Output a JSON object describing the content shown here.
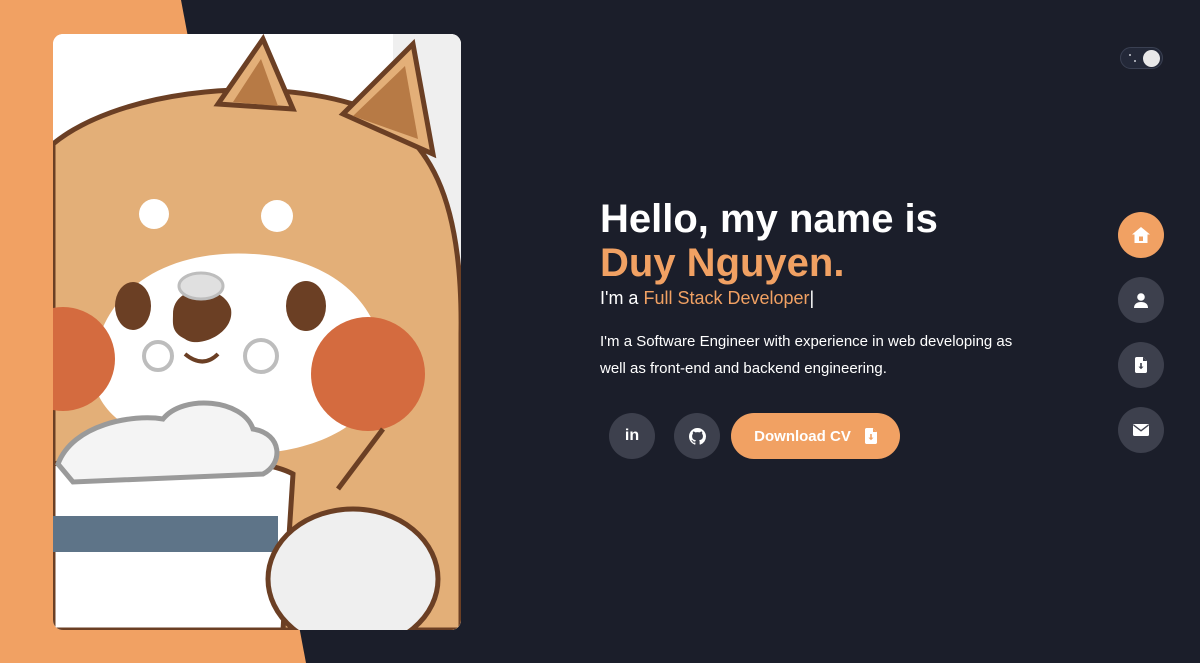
{
  "hero": {
    "greeting": "Hello, my name is",
    "name": "Duy Nguyen.",
    "role_prefix": "I'm a ",
    "role": "Full Stack Developer",
    "cursor": "|",
    "intro": "I'm a Software Engineer with experience in web developing as well as front-end and backend engineering."
  },
  "actions": {
    "linkedin_label": "in",
    "download_cv_label": "Download CV"
  },
  "sidenav": {
    "items": [
      {
        "name": "home",
        "icon": "home-icon",
        "active": true
      },
      {
        "name": "about",
        "icon": "user-icon",
        "active": false
      },
      {
        "name": "resume",
        "icon": "file-icon",
        "active": false
      },
      {
        "name": "contact",
        "icon": "envelope-icon",
        "active": false
      }
    ]
  },
  "theme_toggle": {
    "mode": "dark"
  },
  "colors": {
    "background": "#1b1e2a",
    "accent": "#f1a163",
    "button": "#3d404d",
    "text": "#ffffff"
  },
  "portrait": {
    "subject": "cartoon shiba dog holding a cup with whipped cream"
  }
}
